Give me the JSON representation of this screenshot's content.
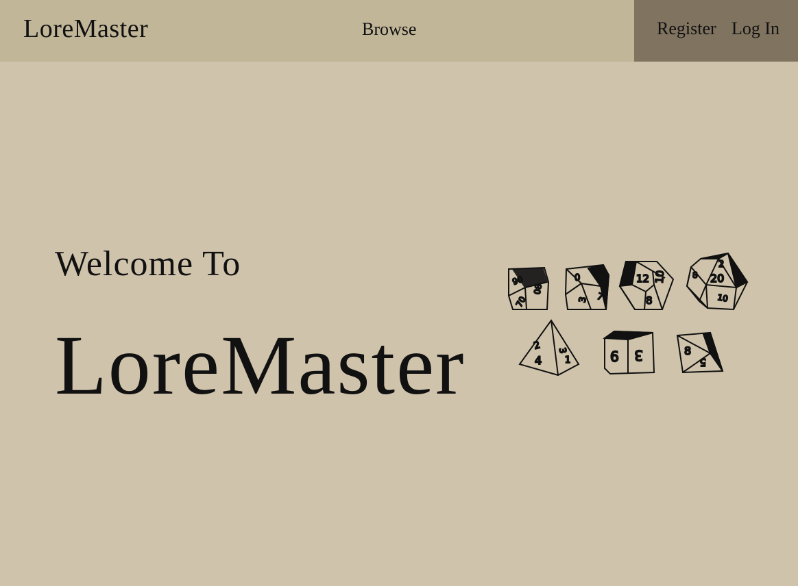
{
  "nav": {
    "brand": "LoreMaster",
    "browse": "Browse",
    "register": "Register",
    "login": "Log In"
  },
  "hero": {
    "welcome": "Welcome To",
    "title": "LoreMaster"
  },
  "dice": {
    "set": [
      "d10-percentile",
      "d10",
      "d12",
      "d20",
      "d4",
      "d6",
      "d8"
    ],
    "labels": {
      "d10p_a": "90",
      "d10p_b": "08",
      "d10p_c": "70",
      "d10_a": "0",
      "d10_b": "7",
      "d10_c": "3",
      "d12_a": "12",
      "d12_b": "10",
      "d12_c": "8",
      "d20_a": "2",
      "d20_b": "20",
      "d20_c": "10",
      "d20_d": "8",
      "d4_a": "2",
      "d4_b": "4",
      "d4_c": "3",
      "d4_d": "1",
      "d6_a": "6",
      "d6_b": "3",
      "d8_a": "8",
      "d8_b": "5"
    }
  },
  "colors": {
    "page_bg": "#cfc3ab",
    "navbar_bg": "#c2b698",
    "auth_bg": "#807460",
    "text": "#111111"
  }
}
